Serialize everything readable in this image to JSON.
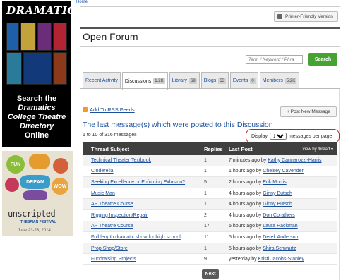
{
  "nav": {
    "home": "Home"
  },
  "ads": {
    "dramatics": {
      "logo": "DRAMATICS",
      "line1": "Search the",
      "line2": "Dramatics",
      "line3": "College Theatre",
      "line4": "Directory",
      "line5": "Online"
    },
    "festival": {
      "bubble1": "FUN",
      "bubble2": "DREAM",
      "bubble3": "WOW",
      "title": "unscripted",
      "brand": "THESPIAN FESTIVAL",
      "dates": "June 23-28, 2014"
    }
  },
  "header": {
    "print_label": "Printer-Friendly Version",
    "title": "Open Forum"
  },
  "search": {
    "placeholder": "Term / Keyword / Phra",
    "button": "Search"
  },
  "tabs": [
    {
      "label": "Recent Activity",
      "count": ""
    },
    {
      "label": "Discussions",
      "count": "1.2K"
    },
    {
      "label": "Library",
      "count": "69"
    },
    {
      "label": "Blogs",
      "count": "53"
    },
    {
      "label": "Events",
      "count": "0"
    },
    {
      "label": "Members",
      "count": "5.2K"
    }
  ],
  "rss_label": "Add To RSS Feeds",
  "post_button": "+ Post New Message",
  "list_title": "The last message(s) which were posted to this Discussion",
  "count_text": "1 to 10 of 316 messages",
  "per_page": {
    "label": "Display",
    "value": "10",
    "suffix": "messages per page"
  },
  "table": {
    "headers": {
      "subject": "Thread Subject",
      "replies": "Replies",
      "last": "Last Post",
      "view": "view by thread"
    },
    "rows": [
      {
        "subject": "Technical Theater Textbook",
        "replies": "1",
        "time": "7 minutes ago by",
        "author": "Kathy Cannarozzi-Harris"
      },
      {
        "subject": "Cinderella",
        "replies": "1",
        "time": "1 hours ago by",
        "author": "Chelsey Cavender"
      },
      {
        "subject": "Seeking Excellence or Enforcing Exlusion?",
        "replies": "5",
        "time": "2 hours ago by",
        "author": "Erik Morris"
      },
      {
        "subject": "Music Man",
        "replies": "1",
        "time": "4 hours ago by",
        "author": "Ginny Butsch"
      },
      {
        "subject": "AP Theatre Course",
        "replies": "1",
        "time": "4 hours ago by",
        "author": "Ginny Butsch"
      },
      {
        "subject": "Rigging Inspection/Repair",
        "replies": "2",
        "time": "4 hours ago by",
        "author": "Don Corathers"
      },
      {
        "subject": "AP Theatre Course",
        "replies": "17",
        "time": "5 hours ago by",
        "author": "Laura Hackman"
      },
      {
        "subject": "Full length dramatic show for high school",
        "replies": "11",
        "time": "5 hours ago by",
        "author": "Derek Anderson"
      },
      {
        "subject": "Prop Shop/Store",
        "replies": "1",
        "time": "5 hours ago by",
        "author": "Shira Schwartz"
      },
      {
        "subject": "Fundraising Projects",
        "replies": "9",
        "time": "yesterday by",
        "author": "Kristi Jacobs-Stanley"
      }
    ]
  },
  "next_label": "Next",
  "colors": {
    "accent": "#47a234",
    "link": "#1a4f9c",
    "highlight": "#c0272d"
  }
}
